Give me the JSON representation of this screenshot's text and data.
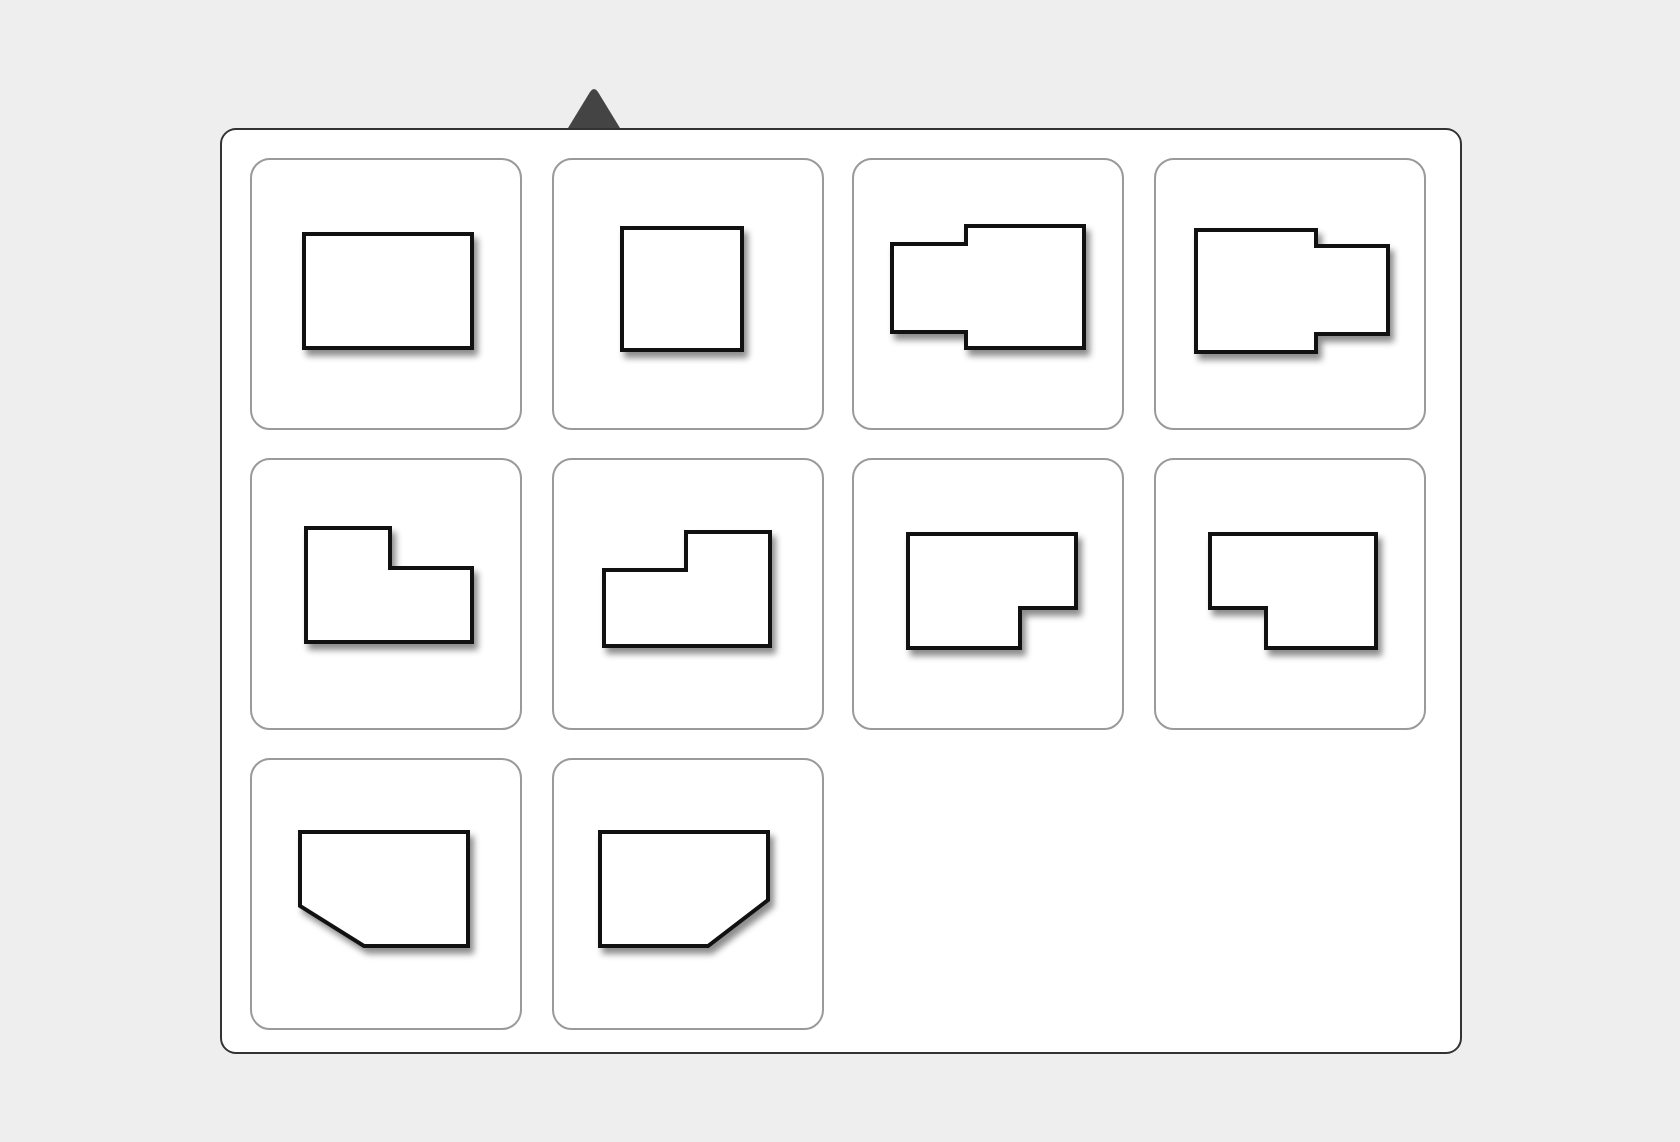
{
  "shape_options": [
    {
      "kind": "rectangle",
      "selected": false
    },
    {
      "kind": "square",
      "selected": false
    },
    {
      "kind": "wing-left",
      "selected": false
    },
    {
      "kind": "wing-right",
      "selected": false
    },
    {
      "kind": "notch-top-right",
      "selected": false
    },
    {
      "kind": "notch-top-left",
      "selected": false
    },
    {
      "kind": "notch-bottom-right",
      "selected": false
    },
    {
      "kind": "notch-bottom-left",
      "selected": false
    },
    {
      "kind": "chamfer-bottom-left",
      "selected": false
    },
    {
      "kind": "chamfer-bottom-right",
      "selected": false
    }
  ]
}
